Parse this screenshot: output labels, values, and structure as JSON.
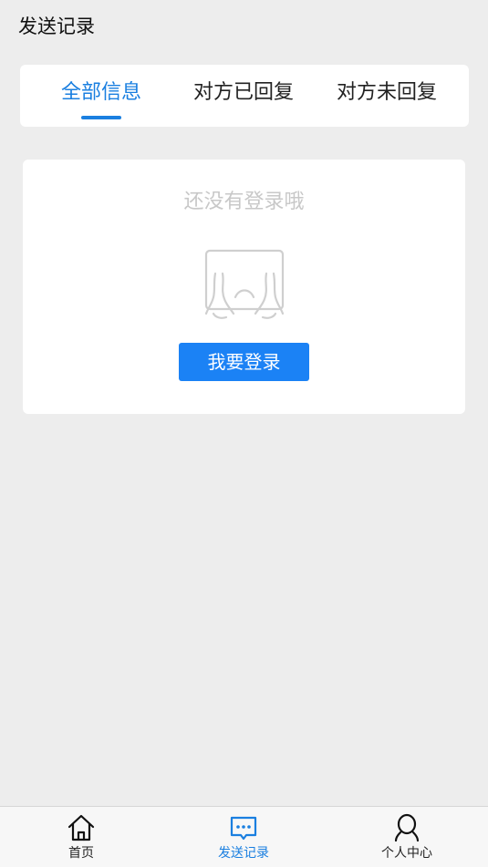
{
  "header": {
    "title": "发送记录"
  },
  "tabs": [
    {
      "label": "全部信息",
      "active": true
    },
    {
      "label": "对方已回复",
      "active": false
    },
    {
      "label": "对方未回复",
      "active": false
    }
  ],
  "empty_state": {
    "message": "还没有登录哦",
    "illustration": "crying-face-illustration",
    "button_label": "我要登录"
  },
  "tabbar": {
    "items": [
      {
        "label": "首页",
        "icon": "home-icon",
        "active": false
      },
      {
        "label": "发送记录",
        "icon": "message-icon",
        "active": true
      },
      {
        "label": "个人中心",
        "icon": "user-icon",
        "active": false
      }
    ]
  },
  "colors": {
    "accent": "#1a7fe0",
    "button": "#1b82f5",
    "background": "#ededed",
    "muted_text": "#c8c8c8"
  }
}
